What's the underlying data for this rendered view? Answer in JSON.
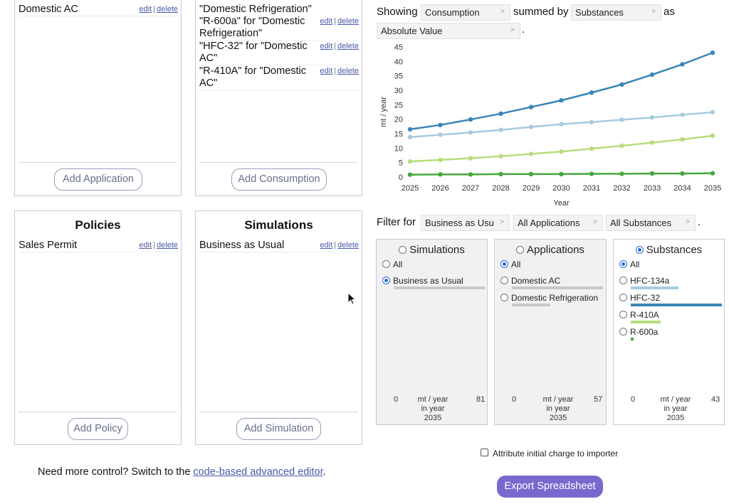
{
  "applications": {
    "items": [
      {
        "label": "Domestic AC",
        "edit": "edit",
        "delete": "delete"
      }
    ],
    "add_label": "Add Application"
  },
  "consumption": {
    "items": [
      {
        "label": "\"Domestic Refrigeration\""
      },
      {
        "label": "\"R-600a\" for \"Domestic Refrigeration\"",
        "edit": "edit",
        "delete": "delete"
      },
      {
        "label": "\"HFC-32\" for \"Domestic AC\"",
        "edit": "edit",
        "delete": "delete"
      },
      {
        "label": "\"R-410A\" for \"Domestic AC\"",
        "edit": "edit",
        "delete": "delete"
      }
    ],
    "add_label": "Add Consumption"
  },
  "policies": {
    "title": "Policies",
    "items": [
      {
        "label": "Sales Permit",
        "edit": "edit",
        "delete": "delete"
      }
    ],
    "add_label": "Add Policy"
  },
  "simulations": {
    "title": "Simulations",
    "items": [
      {
        "label": "Business as Usual",
        "edit": "edit",
        "delete": "delete"
      }
    ],
    "add_label": "Add Simulation"
  },
  "showing": {
    "prefix": "Showing",
    "metric": "Consumption",
    "summed_by_label": "summed by",
    "group": "Substances",
    "as_label": "as",
    "mode": "Absolute Value",
    "period": "."
  },
  "filter": {
    "label": "Filter for",
    "simulation": "Business as Usu",
    "application": "All Applications",
    "substance": "All Substances",
    "period": "."
  },
  "chevron": ">",
  "chart_data": {
    "type": "line",
    "xlabel": "Year",
    "ylabel": "mt / year",
    "x": [
      2025,
      2026,
      2027,
      2028,
      2029,
      2030,
      2031,
      2032,
      2033,
      2034,
      2035
    ],
    "ylim": [
      0,
      45
    ],
    "yticks": [
      0,
      5,
      10,
      15,
      20,
      25,
      30,
      35,
      40,
      45
    ],
    "grid": false,
    "series": [
      {
        "values": [
          16.5,
          18.0,
          19.9,
          21.9,
          24.2,
          26.5,
          29.2,
          32.0,
          35.4,
          39.0,
          43.0
        ],
        "color": "#3a86b8"
      },
      {
        "values": [
          13.8,
          14.6,
          15.4,
          16.3,
          17.3,
          18.3,
          19.0,
          19.8,
          20.6,
          21.5,
          22.4
        ],
        "color": "#a7cbe0"
      },
      {
        "values": [
          5.4,
          5.9,
          6.5,
          7.2,
          8.0,
          8.8,
          9.8,
          10.8,
          11.9,
          13.0,
          14.3
        ],
        "color": "#b7dc7c"
      },
      {
        "values": [
          0.8,
          0.9,
          0.9,
          1.0,
          1.0,
          1.0,
          1.1,
          1.1,
          1.2,
          1.2,
          1.3
        ],
        "color": "#45a83e"
      }
    ]
  },
  "cards": {
    "simulations": {
      "title": "Simulations",
      "all_label": "All",
      "options": [
        {
          "label": "Business as Usual",
          "checked": true,
          "fraction": 1.0
        }
      ],
      "scale_min": "0",
      "scale_unit": "mt / year",
      "scale_in": "in year",
      "scale_year": "2035",
      "scale_max": "81"
    },
    "applications": {
      "title": "Applications",
      "all_label": "All",
      "options": [
        {
          "label": "Domestic AC",
          "checked": false,
          "fraction": 1.0
        },
        {
          "label": "Domestic Refrigeration",
          "checked": false,
          "fraction": 0.42
        }
      ],
      "scale_min": "0",
      "scale_unit": "mt / year",
      "scale_in": "in year",
      "scale_year": "2035",
      "scale_max": "57"
    },
    "substances": {
      "title": "Substances",
      "all_label": "All",
      "options": [
        {
          "label": "HFC-134a",
          "checked": false,
          "fraction": 0.52,
          "color": "#a7cbe0"
        },
        {
          "label": "HFC-32",
          "checked": false,
          "fraction": 1.0,
          "color": "#3a86b8"
        },
        {
          "label": "R-410A",
          "checked": false,
          "fraction": 0.33,
          "color": "#b7dc7c"
        },
        {
          "label": "R-600a",
          "checked": false,
          "fraction": 0.03,
          "color": "#45a83e"
        }
      ],
      "scale_min": "0",
      "scale_unit": "mt / year",
      "scale_in": "in year",
      "scale_year": "2035",
      "scale_max": "43"
    }
  },
  "attribute_label": "Attribute initial charge to importer",
  "advanced": {
    "prefix": "Need more control? Switch to the ",
    "link": "code-based advanced editor",
    "suffix": "."
  },
  "export_label": "Export Spreadsheet"
}
